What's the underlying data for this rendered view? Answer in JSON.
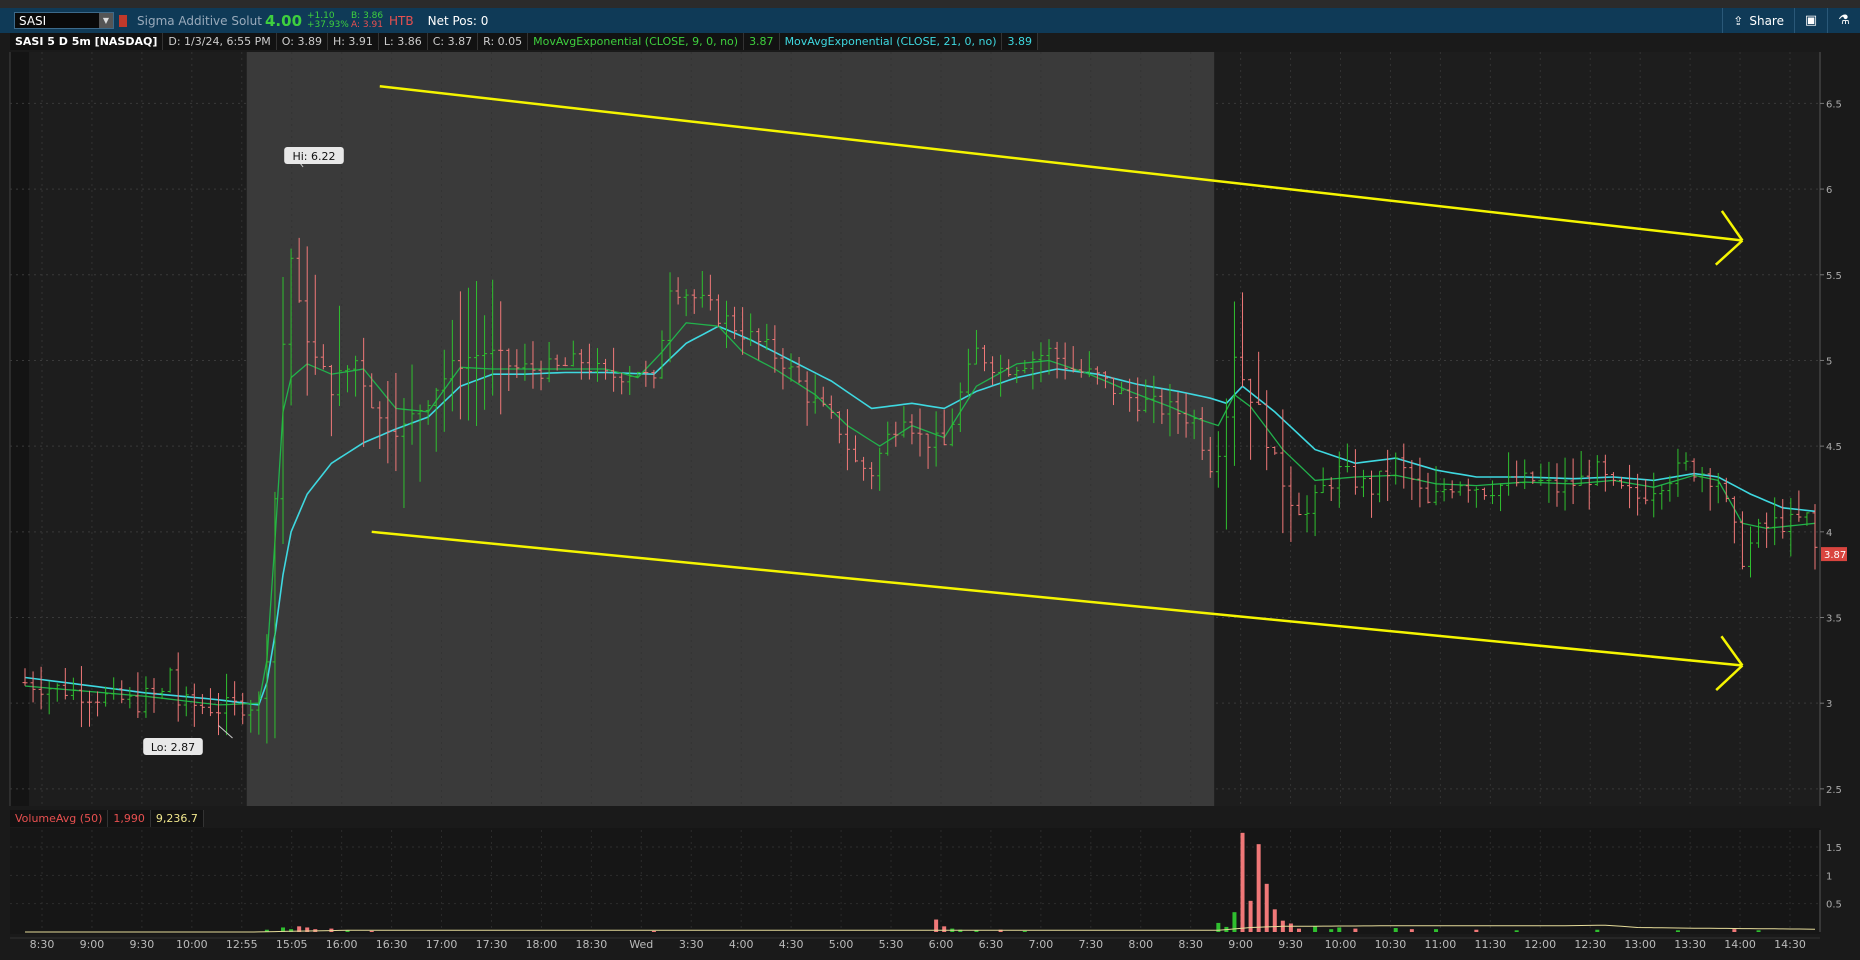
{
  "toolbar": {
    "symbol": "SASI",
    "company": "Sigma Additive Solut",
    "last": "4.00",
    "change": "+1.10",
    "change_pct": "+37.93%",
    "bid": "B: 3.86",
    "ask": "A: 3.91",
    "htb": "HTB",
    "net_pos": "Net Pos: 0",
    "share": "Share"
  },
  "infobar": {
    "title": "SASI 5 D 5m [NASDAQ]",
    "date": "D: 1/3/24, 6:55 PM",
    "open": "O: 3.89",
    "high": "H: 3.91",
    "low": "L: 3.86",
    "close": "C: 3.87",
    "range": "R: 0.05",
    "ema9_label": "MovAvgExponential (CLOSE, 9, 0, no)",
    "ema9_value": "3.87",
    "ema21_label": "MovAvgExponential (CLOSE, 21, 0, no)",
    "ema21_value": "3.89"
  },
  "volume_bar": {
    "label": "VolumeAvg (50)",
    "volume": "1,990",
    "avg": "9,236.7"
  },
  "colors": {
    "up": "#2fbf2f",
    "down": "#f07878",
    "ema9": "#22b14c",
    "ema21": "#3ed8e0",
    "trendline": "#f5f500",
    "vol_avg": "#e6dc9a"
  },
  "chart_data": {
    "type": "candlestick",
    "title": "SASI 5 D 5m [NASDAQ]",
    "ylim": [
      2.4,
      6.8
    ],
    "y_ticks": [
      2.5,
      3,
      3.5,
      4,
      4.5,
      5,
      5.5,
      6,
      6.5
    ],
    "y_tick_labels": [
      "2.5",
      "3",
      "3.5",
      "4",
      "4.5",
      "5",
      "5.5",
      "6",
      "6.5"
    ],
    "last_price_tag": "3.87",
    "hi_label": "Hi: 6.22",
    "lo_label": "Lo: 2.87",
    "x_ticks": [
      "8:30",
      "9:00",
      "9:30",
      "10:00",
      "12:55",
      "15:05",
      "16:00",
      "16:30",
      "17:00",
      "17:30",
      "18:00",
      "18:30",
      "Wed",
      "3:30",
      "4:00",
      "4:30",
      "5:00",
      "5:30",
      "6:00",
      "6:30",
      "7:00",
      "7:30",
      "8:00",
      "8:30",
      "9:00",
      "9:30",
      "10:00",
      "10:30",
      "11:00",
      "11:30",
      "12:00",
      "12:30",
      "13:00",
      "13:30",
      "14:00",
      "14:30"
    ],
    "ohlc_keypoints": [
      [
        0,
        3.12
      ],
      [
        14,
        3.0
      ],
      [
        15,
        3.04
      ],
      [
        17,
        3.05
      ],
      [
        18,
        3.2
      ],
      [
        19,
        3.0
      ],
      [
        24,
        2.97
      ],
      [
        29,
        3.0
      ],
      [
        30,
        3.3
      ],
      [
        31,
        4.2
      ],
      [
        32,
        5.1
      ],
      [
        33,
        5.6
      ],
      [
        34,
        5.3
      ],
      [
        36,
        5.0
      ],
      [
        38,
        4.85
      ],
      [
        41,
        5.0
      ],
      [
        44,
        4.65
      ],
      [
        47,
        4.6
      ],
      [
        51,
        4.85
      ],
      [
        54,
        5.0
      ],
      [
        57,
        5.05
      ],
      [
        61,
        4.95
      ],
      [
        63,
        4.95
      ],
      [
        66,
        4.95
      ],
      [
        69,
        5.0
      ],
      [
        72,
        4.9
      ],
      [
        76,
        4.95
      ],
      [
        78,
        4.85
      ],
      [
        80,
        5.45
      ],
      [
        82,
        5.4
      ],
      [
        85,
        5.3
      ],
      [
        88,
        5.2
      ],
      [
        91,
        5.1
      ],
      [
        94,
        5.0
      ],
      [
        97,
        4.8
      ],
      [
        99,
        4.7
      ],
      [
        101,
        4.6
      ],
      [
        103,
        4.4
      ],
      [
        105,
        4.35
      ],
      [
        107,
        4.55
      ],
      [
        109,
        4.7
      ],
      [
        111,
        4.55
      ],
      [
        114,
        4.5
      ],
      [
        116,
        4.8
      ],
      [
        118,
        5.05
      ],
      [
        121,
        4.95
      ],
      [
        124,
        5.0
      ],
      [
        127,
        5.05
      ],
      [
        130,
        4.95
      ],
      [
        133,
        4.9
      ],
      [
        136,
        4.8
      ],
      [
        139,
        4.75
      ],
      [
        141,
        4.72
      ],
      [
        143,
        4.7
      ],
      [
        145,
        4.65
      ],
      [
        147,
        4.4
      ],
      [
        148,
        4.5
      ],
      [
        149,
        4.7
      ],
      [
        150,
        5.05
      ],
      [
        151,
        4.9
      ],
      [
        153,
        4.7
      ],
      [
        155,
        4.4
      ],
      [
        157,
        4.2
      ],
      [
        159,
        4.1
      ],
      [
        161,
        4.25
      ],
      [
        163,
        4.35
      ],
      [
        165,
        4.3
      ],
      [
        167,
        4.25
      ],
      [
        170,
        4.4
      ],
      [
        172,
        4.3
      ],
      [
        174,
        4.15
      ],
      [
        176,
        4.25
      ],
      [
        178,
        4.3
      ],
      [
        181,
        4.25
      ],
      [
        184,
        4.28
      ],
      [
        187,
        4.3
      ],
      [
        190,
        4.25
      ],
      [
        193,
        4.3
      ],
      [
        195,
        4.35
      ],
      [
        197,
        4.25
      ],
      [
        200,
        4.2
      ],
      [
        203,
        4.3
      ],
      [
        206,
        4.38
      ],
      [
        208,
        4.35
      ],
      [
        210,
        4.3
      ],
      [
        212,
        4.0
      ],
      [
        213,
        3.85
      ],
      [
        215,
        4.0
      ],
      [
        217,
        4.05
      ],
      [
        219,
        4.05
      ],
      [
        221,
        4.08
      ],
      [
        222,
        3.9
      ]
    ],
    "ema9_points": [
      [
        0,
        3.1
      ],
      [
        15,
        3.04
      ],
      [
        24,
        2.99
      ],
      [
        29,
        3.0
      ],
      [
        30,
        3.25
      ],
      [
        31,
        3.95
      ],
      [
        32,
        4.7
      ],
      [
        33,
        4.9
      ],
      [
        35,
        4.98
      ],
      [
        38,
        4.92
      ],
      [
        42,
        4.95
      ],
      [
        46,
        4.72
      ],
      [
        50,
        4.7
      ],
      [
        54,
        4.96
      ],
      [
        58,
        4.95
      ],
      [
        62,
        4.95
      ],
      [
        67,
        4.95
      ],
      [
        72,
        4.95
      ],
      [
        76,
        4.9
      ],
      [
        79,
        5.05
      ],
      [
        82,
        5.22
      ],
      [
        86,
        5.2
      ],
      [
        89,
        5.05
      ],
      [
        93,
        4.95
      ],
      [
        98,
        4.8
      ],
      [
        102,
        4.62
      ],
      [
        106,
        4.5
      ],
      [
        110,
        4.62
      ],
      [
        114,
        4.55
      ],
      [
        118,
        4.85
      ],
      [
        123,
        4.98
      ],
      [
        127,
        5.0
      ],
      [
        132,
        4.92
      ],
      [
        137,
        4.82
      ],
      [
        142,
        4.73
      ],
      [
        146,
        4.65
      ],
      [
        148,
        4.62
      ],
      [
        150,
        4.8
      ],
      [
        152,
        4.73
      ],
      [
        156,
        4.48
      ],
      [
        160,
        4.3
      ],
      [
        165,
        4.32
      ],
      [
        170,
        4.33
      ],
      [
        175,
        4.28
      ],
      [
        180,
        4.27
      ],
      [
        186,
        4.29
      ],
      [
        192,
        4.28
      ],
      [
        197,
        4.3
      ],
      [
        202,
        4.26
      ],
      [
        207,
        4.33
      ],
      [
        210,
        4.3
      ],
      [
        213,
        4.05
      ],
      [
        216,
        4.02
      ],
      [
        222,
        4.05
      ]
    ],
    "ema21_points": [
      [
        0,
        3.15
      ],
      [
        15,
        3.06
      ],
      [
        24,
        3.02
      ],
      [
        29,
        2.99
      ],
      [
        30,
        3.12
      ],
      [
        31,
        3.4
      ],
      [
        32,
        3.75
      ],
      [
        33,
        4.0
      ],
      [
        35,
        4.22
      ],
      [
        38,
        4.4
      ],
      [
        42,
        4.52
      ],
      [
        46,
        4.6
      ],
      [
        50,
        4.67
      ],
      [
        54,
        4.85
      ],
      [
        58,
        4.92
      ],
      [
        62,
        4.92
      ],
      [
        67,
        4.93
      ],
      [
        72,
        4.93
      ],
      [
        78,
        4.92
      ],
      [
        82,
        5.1
      ],
      [
        86,
        5.2
      ],
      [
        90,
        5.12
      ],
      [
        95,
        5.0
      ],
      [
        100,
        4.88
      ],
      [
        105,
        4.72
      ],
      [
        110,
        4.75
      ],
      [
        114,
        4.72
      ],
      [
        118,
        4.82
      ],
      [
        123,
        4.9
      ],
      [
        128,
        4.95
      ],
      [
        133,
        4.92
      ],
      [
        138,
        4.86
      ],
      [
        143,
        4.82
      ],
      [
        147,
        4.78
      ],
      [
        149,
        4.75
      ],
      [
        151,
        4.85
      ],
      [
        155,
        4.7
      ],
      [
        160,
        4.48
      ],
      [
        165,
        4.4
      ],
      [
        170,
        4.43
      ],
      [
        175,
        4.36
      ],
      [
        180,
        4.32
      ],
      [
        186,
        4.32
      ],
      [
        192,
        4.31
      ],
      [
        197,
        4.32
      ],
      [
        202,
        4.3
      ],
      [
        207,
        4.34
      ],
      [
        210,
        4.32
      ],
      [
        214,
        4.22
      ],
      [
        218,
        4.14
      ],
      [
        222,
        4.12
      ]
    ],
    "bar_count": 223,
    "trend_upper": [
      [
        44,
        6.6
      ],
      [
        213,
        5.7
      ]
    ],
    "trend_lower": [
      [
        43,
        4.0
      ],
      [
        213,
        3.22
      ]
    ],
    "sessions": [
      {
        "from": 0,
        "to": 27,
        "shade": "dark"
      },
      {
        "from": 28,
        "to": 147,
        "shade": "light"
      },
      {
        "from": 148,
        "to": 222,
        "shade": "dark"
      }
    ],
    "volume": {
      "label": "VolumeAvg (50)",
      "ylim": [
        0,
        1.8
      ],
      "y_ticks": [
        0.5,
        1,
        1.5
      ],
      "y_tick_labels": [
        "0.5",
        "1",
        "1.5"
      ],
      "spikes": [
        [
          30,
          0.04
        ],
        [
          32,
          0.08
        ],
        [
          33,
          0.05
        ],
        [
          34,
          0.1
        ],
        [
          35,
          0.08
        ],
        [
          36,
          0.05
        ],
        [
          38,
          0.06
        ],
        [
          40,
          0.03
        ],
        [
          43,
          0.02
        ],
        [
          78,
          0.02
        ],
        [
          113,
          0.22
        ],
        [
          114,
          0.1
        ],
        [
          115,
          0.06
        ],
        [
          116,
          0.04
        ],
        [
          118,
          0.03
        ],
        [
          121,
          0.04
        ],
        [
          124,
          0.02
        ],
        [
          148,
          0.16
        ],
        [
          149,
          0.09
        ],
        [
          150,
          0.35
        ],
        [
          151,
          1.75
        ],
        [
          152,
          0.55
        ],
        [
          153,
          1.55
        ],
        [
          154,
          0.85
        ],
        [
          155,
          0.4
        ],
        [
          156,
          0.2
        ],
        [
          157,
          0.15
        ],
        [
          158,
          0.06
        ],
        [
          160,
          0.1
        ],
        [
          162,
          0.05
        ],
        [
          163,
          0.08
        ],
        [
          165,
          0.06
        ],
        [
          170,
          0.07
        ],
        [
          172,
          0.05
        ],
        [
          175,
          0.05
        ],
        [
          180,
          0.04
        ],
        [
          185,
          0.03
        ],
        [
          195,
          0.04
        ],
        [
          205,
          0.03
        ],
        [
          212,
          0.05
        ],
        [
          215,
          0.03
        ]
      ],
      "avg_points": [
        [
          0,
          0.0
        ],
        [
          28,
          0.0
        ],
        [
          40,
          0.03
        ],
        [
          113,
          0.03
        ],
        [
          148,
          0.03
        ],
        [
          152,
          0.08
        ],
        [
          156,
          0.1
        ],
        [
          170,
          0.11
        ],
        [
          190,
          0.11
        ],
        [
          196,
          0.12
        ],
        [
          200,
          0.08
        ],
        [
          205,
          0.07
        ],
        [
          222,
          0.05
        ]
      ]
    }
  }
}
